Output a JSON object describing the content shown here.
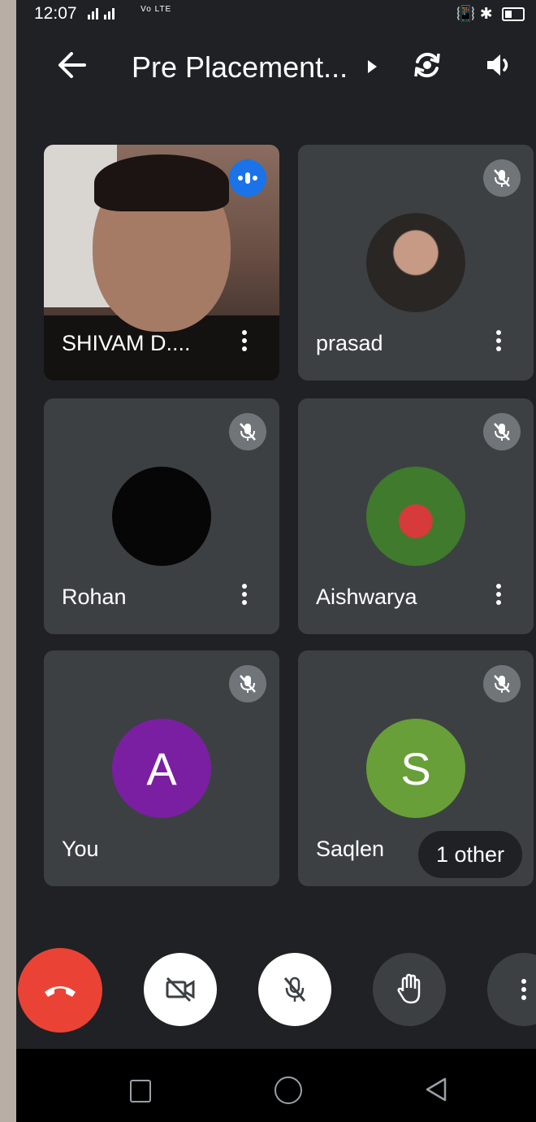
{
  "status_bar": {
    "time": "12:07",
    "signal_text": "Vo LTE"
  },
  "header": {
    "title": "Pre Placement...",
    "icons": [
      "back-arrow-icon",
      "chevron-right-icon",
      "switch-camera-icon",
      "speaker-icon"
    ]
  },
  "participants": [
    {
      "name": "SHIVAM D....",
      "status": "speaking",
      "video": true
    },
    {
      "name": "prasad",
      "status": "muted",
      "avatar": "photo"
    },
    {
      "name": "Rohan",
      "status": "muted",
      "avatar": "photo-dark"
    },
    {
      "name": "Aishwarya",
      "status": "muted",
      "avatar": "photo"
    },
    {
      "name": "You",
      "status": "muted",
      "avatar_letter": "A",
      "avatar_color": "#7b1fa2"
    },
    {
      "name": "Saqlen",
      "status": "muted",
      "avatar_letter": "S",
      "avatar_color": "#689f38"
    }
  ],
  "overflow_label": "1 other",
  "controls": {
    "end_call_color": "#ea4335",
    "items": [
      "end-call",
      "camera-off",
      "mic-off",
      "raise-hand",
      "more-options"
    ]
  },
  "colors": {
    "background": "#202124",
    "tile": "#3c4043",
    "accent_blue": "#1a73e8"
  }
}
